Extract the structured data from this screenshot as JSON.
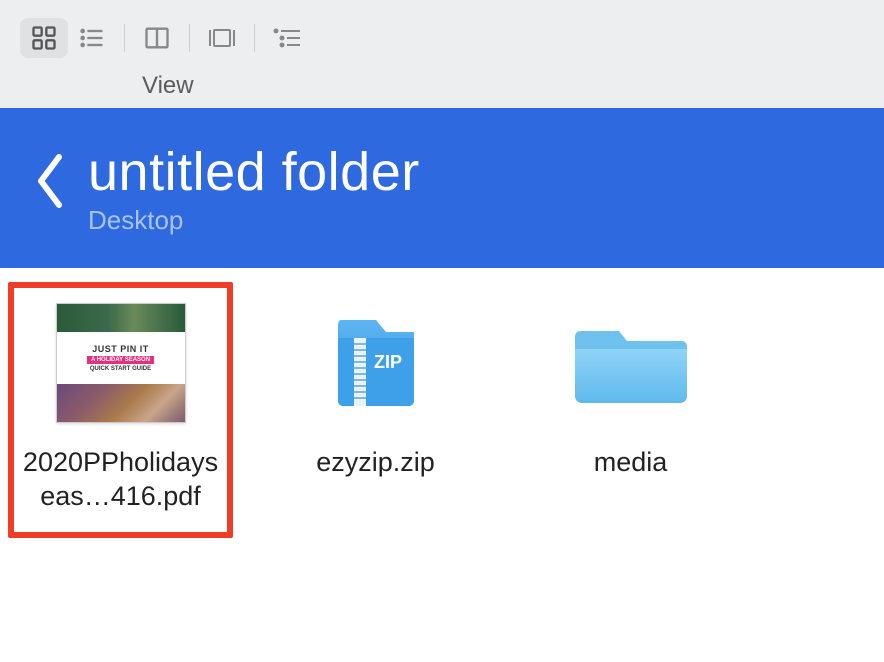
{
  "toolbar": {
    "view_label": "View"
  },
  "header": {
    "title": "untitled folder",
    "subtitle": "Desktop"
  },
  "files": [
    {
      "name": "2020PPholidayseas…416.pdf",
      "type": "pdf",
      "selected": true,
      "thumb": {
        "line1": "JUST PIN IT",
        "line2": "A HOLIDAY SEASON",
        "line3": "QUICK START GUIDE"
      }
    },
    {
      "name": "ezyzip.zip",
      "type": "zip",
      "selected": false,
      "zip_label": "ZIP"
    },
    {
      "name": "media",
      "type": "folder",
      "selected": false
    }
  ]
}
